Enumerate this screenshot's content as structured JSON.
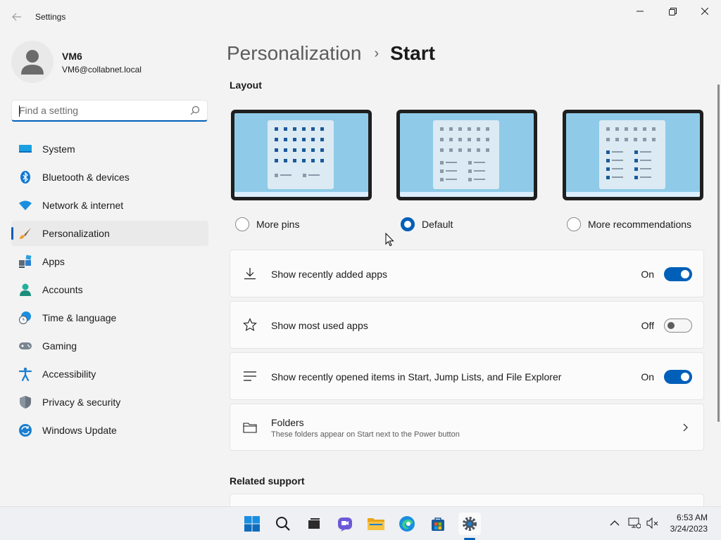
{
  "window": {
    "title": "Settings"
  },
  "user": {
    "name": "VM6",
    "email": "VM6@collabnet.local"
  },
  "search": {
    "placeholder": "Find a setting",
    "value": ""
  },
  "sidebar": {
    "items": [
      {
        "label": "System",
        "icon": "system-icon",
        "active": false
      },
      {
        "label": "Bluetooth & devices",
        "icon": "bluetooth-icon",
        "active": false
      },
      {
        "label": "Network & internet",
        "icon": "wifi-icon",
        "active": false
      },
      {
        "label": "Personalization",
        "icon": "brush-icon",
        "active": true
      },
      {
        "label": "Apps",
        "icon": "apps-icon",
        "active": false
      },
      {
        "label": "Accounts",
        "icon": "accounts-icon",
        "active": false
      },
      {
        "label": "Time & language",
        "icon": "clock-globe-icon",
        "active": false
      },
      {
        "label": "Gaming",
        "icon": "gamepad-icon",
        "active": false
      },
      {
        "label": "Accessibility",
        "icon": "accessibility-icon",
        "active": false
      },
      {
        "label": "Privacy & security",
        "icon": "shield-icon",
        "active": false
      },
      {
        "label": "Windows Update",
        "icon": "update-icon",
        "active": false
      }
    ]
  },
  "breadcrumb": {
    "parent": "Personalization",
    "separator": "›",
    "current": "Start"
  },
  "layout": {
    "title": "Layout",
    "options": [
      {
        "label": "More pins",
        "selected": false
      },
      {
        "label": "Default",
        "selected": true
      },
      {
        "label": "More recommendations",
        "selected": false
      }
    ]
  },
  "settings": [
    {
      "label": "Show recently added apps",
      "state": "On",
      "on": true,
      "icon": "download-icon"
    },
    {
      "label": "Show most used apps",
      "state": "Off",
      "on": false,
      "icon": "star-icon"
    },
    {
      "label": "Show recently opened items in Start, Jump Lists, and File Explorer",
      "state": "On",
      "on": true,
      "icon": "list-icon"
    }
  ],
  "folders": {
    "title": "Folders",
    "description": "These folders appear on Start next to the Power button"
  },
  "related": {
    "title": "Related support"
  },
  "taskbar": {
    "time": "6:53 AM",
    "date": "3/24/2023",
    "apps": [
      "start-icon",
      "search-icon",
      "task-view-icon",
      "chat-icon",
      "file-explorer-icon",
      "edge-icon",
      "store-icon",
      "settings-icon"
    ]
  },
  "colors": {
    "accent": "#005fb8"
  }
}
